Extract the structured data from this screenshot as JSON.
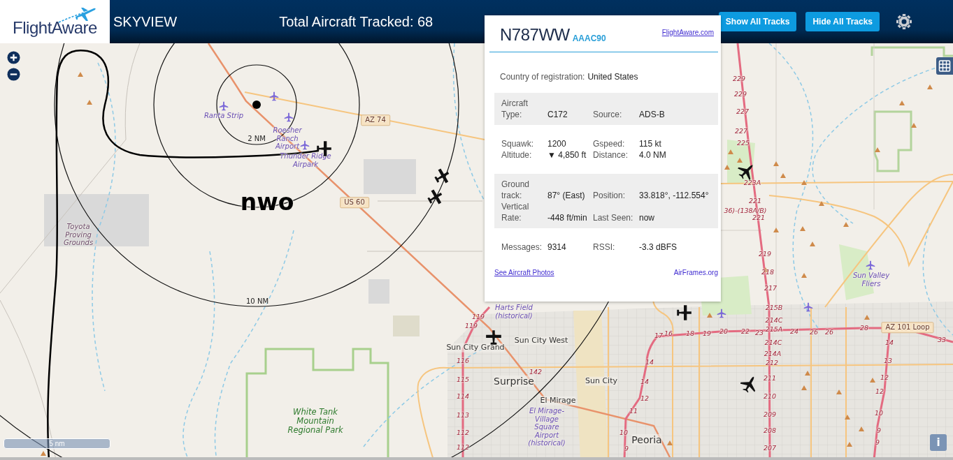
{
  "header": {
    "logo": "FlightAware",
    "title": "SKYVIEW",
    "total": "Total Aircraft Tracked: 68",
    "buttons": [
      "Show All Tracks",
      "Hide All Tracks"
    ]
  },
  "popup": {
    "registration": "N787WW",
    "hex": "AAAC90",
    "site_link": "FlightAware.com",
    "country_label": "Country of registration:",
    "country": "United States",
    "sections": [
      {
        "shaded": true,
        "fields": [
          {
            "label": "Aircraft Type:",
            "value": "C172"
          },
          {
            "label": "Source:",
            "value": "ADS-B"
          }
        ]
      },
      {
        "shaded": false,
        "fields": [
          {
            "label": "Squawk:",
            "value": "1200"
          },
          {
            "label": "Gspeed:",
            "value": "115 kt"
          },
          {
            "label": "Altitude:",
            "value": "▼ 4,850 ft"
          },
          {
            "label": "Distance:",
            "value": "4.0 NM"
          }
        ]
      },
      {
        "shaded": true,
        "fields": [
          {
            "label": "Ground track:",
            "value": "87° (East)"
          },
          {
            "label": "Position:",
            "value": "33.818°, -112.554°"
          },
          {
            "label": "Vertical Rate:",
            "value": "-448 ft/min"
          },
          {
            "label": "Last Seen:",
            "value": "now"
          }
        ]
      },
      {
        "shaded": false,
        "fields": [
          {
            "label": "Messages:",
            "value": "9314"
          },
          {
            "label": "RSSI:",
            "value": "-3.3 dBFS"
          }
        ]
      }
    ],
    "photos_link": "See Aircraft Photos",
    "airframes_link": "AirFrames.org"
  },
  "map": {
    "scale": "5 nm",
    "info": "i",
    "labels": [
      {
        "text": "Ranta Strip",
        "kind": "airport"
      },
      {
        "text": "Roesher Ranch Airport",
        "kind": "airport"
      },
      {
        "text": "Thunder Ridge Airpark",
        "kind": "airport"
      },
      {
        "text": "2 NM",
        "kind": "ring"
      },
      {
        "text": "nwo",
        "kind": "track"
      },
      {
        "text": "AZ 74",
        "kind": "shield"
      },
      {
        "text": "US 60",
        "kind": "shield"
      },
      {
        "text": "Toyota Proving Grounds",
        "kind": "place"
      },
      {
        "text": "10 NM",
        "kind": "ring"
      },
      {
        "text": "White Tank Mountain Regional Park",
        "kind": "park"
      },
      {
        "text": "Harts Field (historical)",
        "kind": "airport"
      },
      {
        "text": "Sun City Grand",
        "kind": "city"
      },
      {
        "text": "Sun City West",
        "kind": "city"
      },
      {
        "text": "Surprise",
        "kind": "city-large"
      },
      {
        "text": "Sun City",
        "kind": "city"
      },
      {
        "text": "El Mirage",
        "kind": "city"
      },
      {
        "text": "El Mirage-Village Square Airport (historical)",
        "kind": "airport"
      },
      {
        "text": "Peoria",
        "kind": "city-large"
      },
      {
        "text": "Sun Valley Fliers",
        "kind": "airport"
      },
      {
        "text": "AZ 101 Loop",
        "kind": "shield"
      },
      {
        "text": "229",
        "kind": "exit"
      },
      {
        "text": "229",
        "kind": "exit"
      },
      {
        "text": "227",
        "kind": "exit"
      },
      {
        "text": "227",
        "kind": "exit"
      },
      {
        "text": "225",
        "kind": "exit"
      },
      {
        "text": "223A",
        "kind": "exit"
      },
      {
        "text": "221",
        "kind": "exit"
      },
      {
        "text": "36)-(138A/B)",
        "kind": "exit"
      },
      {
        "text": "221",
        "kind": "exit"
      },
      {
        "text": "219",
        "kind": "exit"
      },
      {
        "text": "218",
        "kind": "exit"
      },
      {
        "text": "217",
        "kind": "exit"
      },
      {
        "text": "215B",
        "kind": "exit"
      },
      {
        "text": "214C",
        "kind": "exit"
      },
      {
        "text": "215A",
        "kind": "exit"
      },
      {
        "text": "214C",
        "kind": "exit"
      },
      {
        "text": "214A",
        "kind": "exit"
      },
      {
        "text": "212",
        "kind": "exit"
      },
      {
        "text": "211",
        "kind": "exit"
      },
      {
        "text": "210",
        "kind": "exit"
      },
      {
        "text": "209",
        "kind": "exit"
      },
      {
        "text": "208",
        "kind": "exit"
      },
      {
        "text": "207",
        "kind": "exit"
      },
      {
        "text": "20",
        "kind": "exit"
      },
      {
        "text": "22",
        "kind": "exit"
      },
      {
        "text": "23",
        "kind": "exit"
      },
      {
        "text": "24",
        "kind": "exit"
      },
      {
        "text": "26",
        "kind": "exit"
      },
      {
        "text": "26",
        "kind": "exit"
      },
      {
        "text": "28",
        "kind": "exit"
      },
      {
        "text": "33",
        "kind": "exit"
      },
      {
        "text": "14",
        "kind": "exit"
      },
      {
        "text": "13",
        "kind": "exit"
      },
      {
        "text": "12",
        "kind": "exit"
      },
      {
        "text": "12",
        "kind": "exit"
      },
      {
        "text": "10",
        "kind": "exit"
      },
      {
        "text": "9",
        "kind": "exit"
      },
      {
        "text": "9",
        "kind": "exit"
      },
      {
        "text": "17",
        "kind": "exit"
      },
      {
        "text": "16",
        "kind": "exit"
      },
      {
        "text": "18",
        "kind": "exit"
      },
      {
        "text": "19",
        "kind": "exit"
      },
      {
        "text": "142",
        "kind": "exit"
      },
      {
        "text": "14",
        "kind": "exit"
      },
      {
        "text": "14",
        "kind": "exit"
      },
      {
        "text": "12",
        "kind": "exit"
      },
      {
        "text": "11",
        "kind": "exit"
      },
      {
        "text": "10",
        "kind": "exit"
      },
      {
        "text": "9",
        "kind": "exit"
      },
      {
        "text": "119",
        "kind": "exit"
      },
      {
        "text": "119",
        "kind": "exit"
      },
      {
        "text": "116",
        "kind": "exit"
      },
      {
        "text": "115",
        "kind": "exit"
      },
      {
        "text": "114",
        "kind": "exit"
      },
      {
        "text": "113",
        "kind": "exit"
      },
      {
        "text": "112",
        "kind": "exit"
      },
      {
        "text": "112",
        "kind": "exit"
      }
    ]
  }
}
